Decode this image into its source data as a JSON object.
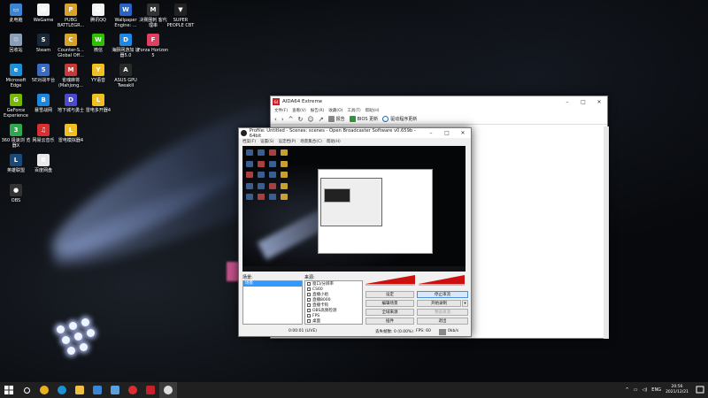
{
  "desktop_icons": [
    {
      "label": "此电脑",
      "color": "#3a86d6",
      "glyph": "▭"
    },
    {
      "label": "WeGame",
      "color": "#f2f2f2",
      "glyph": "W"
    },
    {
      "label": "PUBG BATTLEGR...",
      "color": "#d9a02c",
      "glyph": "P"
    },
    {
      "label": "腾讯QQ",
      "color": "#f4f4f4",
      "glyph": "Q"
    },
    {
      "label": "Wallpaper Engine: ...",
      "color": "#2864c8",
      "glyph": "W"
    },
    {
      "label": "决赛圈刺 客代理串",
      "color": "#333333",
      "glyph": "M"
    },
    {
      "label": "SUPER PEOPLE CBT",
      "color": "#222222",
      "glyph": "▼"
    },
    {
      "label": "回收站",
      "color": "#8aa0b8",
      "glyph": "♲"
    },
    {
      "label": "Steam",
      "color": "#1b2838",
      "glyph": "S"
    },
    {
      "label": "Counter-S... Global Off...",
      "color": "#d6a228",
      "glyph": "C"
    },
    {
      "label": "微信",
      "color": "#2dc100",
      "glyph": "W"
    },
    {
      "label": "海豚网游加 速器5.0",
      "color": "#1e88e5",
      "glyph": "D"
    },
    {
      "label": "Forza Horizon 5",
      "color": "#e04060",
      "glyph": "F"
    },
    {
      "label": "Microsoft Edge",
      "color": "#1f8fd6",
      "glyph": "e"
    },
    {
      "label": "5E对战平台",
      "color": "#3a6bc4",
      "glyph": "5"
    },
    {
      "label": "雀魂麻将 (Mahjong...",
      "color": "#c83a3a",
      "glyph": "M"
    },
    {
      "label": "YY语音",
      "color": "#f0c020",
      "glyph": "Y"
    },
    {
      "label": "ASUS GPU TweakII",
      "color": "#2a2a2a",
      "glyph": "A"
    },
    {
      "label": "GeForce Experience",
      "color": "#76b900",
      "glyph": "G"
    },
    {
      "label": "暴雪战网",
      "color": "#1a88e0",
      "glyph": "B"
    },
    {
      "label": "地下城与勇士",
      "color": "#4a4ad0",
      "glyph": "D"
    },
    {
      "label": "雷电多开器4",
      "color": "#f0c020",
      "glyph": "L"
    },
    {
      "label": "360 极速浏 览器X",
      "color": "#2fa84f",
      "glyph": "3"
    },
    {
      "label": "网易云音乐",
      "color": "#d83030",
      "glyph": "♫"
    },
    {
      "label": "雷电模拟器4",
      "color": "#f0c020",
      "glyph": "L"
    },
    {
      "label": "英雄联盟",
      "color": "#1a4a7a",
      "glyph": "L"
    },
    {
      "label": "百度网盘",
      "color": "#e8e8e8",
      "glyph": "B"
    },
    {
      "label": "OBS",
      "color": "#333333",
      "glyph": "●"
    }
  ],
  "aida": {
    "title": "AIDA64 Extreme",
    "logo": "64",
    "menu": [
      "文件(F)",
      "查看(V)",
      "报告(R)",
      "收藏(O)",
      "工具(T)",
      "帮助(H)"
    ],
    "toolbar": {
      "report": "报告",
      "bios": "BIOS 更新",
      "driver": "驱动程序更新"
    }
  },
  "obs": {
    "title": "Profile: Untitled - Scenes: scenes - Open Broadcaster Software v0.659b - 64bit",
    "menu": [
      "档案(F)",
      "设置(S)",
      "设定档(P)",
      "场景集合(C)",
      "帮助(H)"
    ],
    "scenes_header": "场景:",
    "sources_header": "来源:",
    "scene_selected": "场景",
    "sources": [
      "窗口/分辨率",
      "CS60",
      "直播小组",
      "直播8000",
      "直播卡钩",
      "OBS高频检测",
      "FPS",
      "桌面"
    ],
    "buttons": {
      "settings": "设定",
      "stop_stream": "停止串流",
      "edit_scene": "编辑场景",
      "start_record": "开始录制",
      "global_sources": "全域来源",
      "preview": "预览串流",
      "plugins": "插件",
      "exit": "退出"
    },
    "status": {
      "time": "0:00:01 (LIVE)",
      "dropped": "丢失帧数: 0 (0.00%)",
      "fps": "FPS: 60",
      "bitrate": "0kb/s"
    }
  },
  "taskbar": {
    "lang": "ENG",
    "time": "20:56",
    "date": "2021/12/21"
  }
}
